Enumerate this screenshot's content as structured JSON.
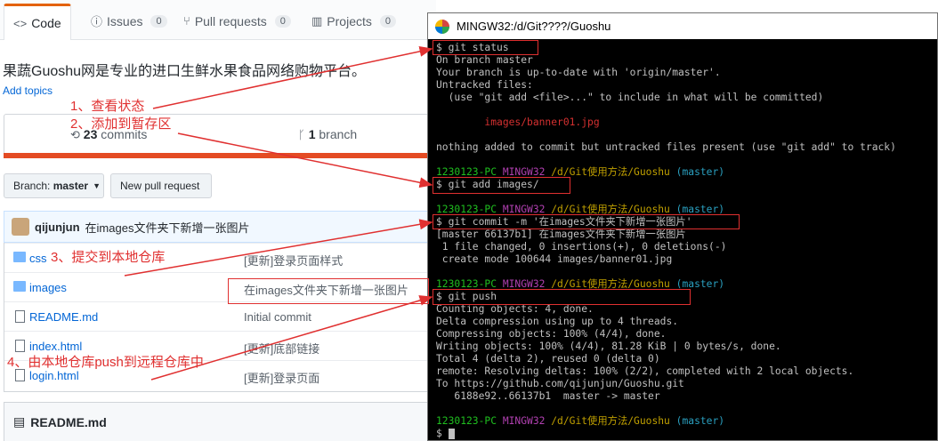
{
  "github": {
    "tabs": [
      {
        "label": "Code",
        "icon": "code-icon"
      },
      {
        "label": "Issues",
        "count": "0",
        "icon": "issue-icon"
      },
      {
        "label": "Pull requests",
        "count": "0",
        "icon": "pull-request-icon"
      },
      {
        "label": "Projects",
        "count": "0",
        "icon": "project-icon"
      }
    ],
    "description": "果蔬Guoshu网是专业的进口生鲜水果食品网络购物平台。",
    "add_topics": "Add topics",
    "summary": {
      "commits_count": "23",
      "commits_label": "commits",
      "branch_count": "1",
      "branch_label": "branch"
    },
    "branch_button": {
      "label": "Branch:",
      "value": "master"
    },
    "new_pr_button": "New pull request",
    "latest_commit": {
      "author": "qijunjun",
      "message": "在images文件夹下新增一张图片"
    },
    "files": [
      {
        "name": "css",
        "type": "folder",
        "message": "[更新]登录页面样式"
      },
      {
        "name": "images",
        "type": "folder",
        "message": "在images文件夹下新增一张图片"
      },
      {
        "name": "README.md",
        "type": "file",
        "message": "Initial commit"
      },
      {
        "name": "index.html",
        "type": "file",
        "message": "[更新]底部链接"
      },
      {
        "name": "login.html",
        "type": "file",
        "message": "[更新]登录页面"
      }
    ],
    "readme_header": "README.md"
  },
  "terminal": {
    "title": "MINGW32:/d/Git????/Guoshu",
    "prompt": {
      "user": "1230123-PC",
      "env": "MINGW32",
      "path": "/d/Git使用方法/Guoshu",
      "branch": "(master)"
    },
    "lines": {
      "cmd_status": "$ git status",
      "status_1": "On branch master",
      "status_2": "Your branch is up-to-date with 'origin/master'.",
      "status_3": "Untracked files:",
      "status_4": "  (use \"git add <file>...\" to include in what will be committed)",
      "status_untracked": "        images/banner01.jpg",
      "status_5": "nothing added to commit but untracked files present (use \"git add\" to track)",
      "cmd_add": "$ git add images/",
      "cmd_commit": "$ git commit -m '在images文件夹下新增一张图片'",
      "commit_1": "[master 66137b1] 在images文件夹下新增一张图片",
      "commit_2": " 1 file changed, 0 insertions(+), 0 deletions(-)",
      "commit_3": " create mode 100644 images/banner01.jpg",
      "cmd_push": "$ git push",
      "push_1": "Counting objects: 4, done.",
      "push_2": "Delta compression using up to 4 threads.",
      "push_3": "Compressing objects: 100% (4/4), done.",
      "push_4": "Writing objects: 100% (4/4), 81.28 KiB | 0 bytes/s, done.",
      "push_5": "Total 4 (delta 2), reused 0 (delta 0)",
      "push_6": "remote: Resolving deltas: 100% (2/2), completed with 2 local objects.",
      "push_7": "To https://github.com/qijunjun/Guoshu.git",
      "push_8": "   6188e92..66137b1  master -> master",
      "final_prompt": "$ "
    }
  },
  "annotations": {
    "step1": "1、查看状态",
    "step2": "2、添加到暂存区",
    "step3": "3、提交到本地仓库",
    "step4": "4、由本地仓库push到远程仓库中"
  },
  "colors": {
    "annotation": "#e03030",
    "accent_tab": "#e36209",
    "language_bar": "#e44b23",
    "link": "#0366d6"
  }
}
